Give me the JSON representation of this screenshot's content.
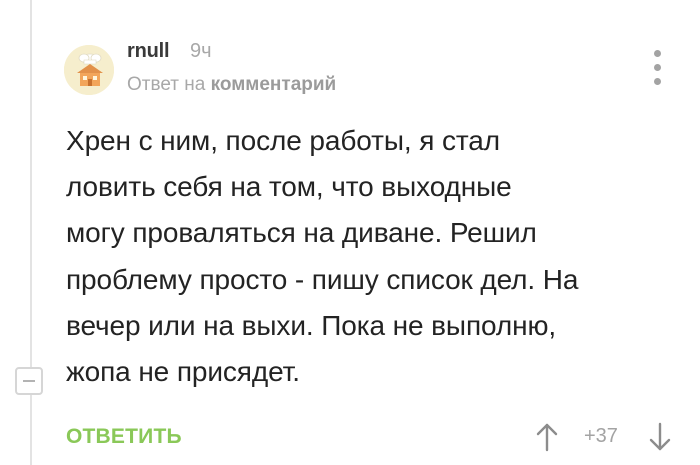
{
  "comment": {
    "author": "rnull",
    "time_ago": "9ч",
    "reply_prefix": "Ответ на",
    "reply_link": "комментарий",
    "text": "Хрен с ним, после работы, я стал\nловить себя на том, что выходные\nмогу проваляться на диване. Решил\nпроблему просто - пишу список дел. На\nвечер или на выхи. Пока не выполню,\nжопа не присядет.",
    "reply_button": "ОТВЕТИТЬ",
    "rating": "+37"
  },
  "icons": {
    "avatar": "house-with-chef-hat-avatar",
    "more": "vertical-ellipsis-icon",
    "collapse": "minus-square-icon",
    "vote_up": "arrow-up-icon",
    "vote_down": "arrow-down-icon"
  },
  "colors": {
    "reply_button": "#8ac858",
    "muted_text": "#a8a8a8",
    "body_text": "#232323",
    "thread_line": "#e3e3e3"
  }
}
